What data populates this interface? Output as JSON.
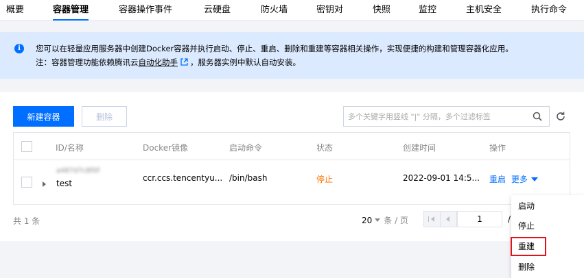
{
  "tabs": [
    {
      "label": "概要"
    },
    {
      "label": "容器管理"
    },
    {
      "label": "容器操作事件"
    },
    {
      "label": "云硬盘"
    },
    {
      "label": "防火墙"
    },
    {
      "label": "密钥对"
    },
    {
      "label": "快照"
    },
    {
      "label": "监控"
    },
    {
      "label": "主机安全"
    },
    {
      "label": "执行命令"
    }
  ],
  "active_tab": "容器管理",
  "banner": {
    "line1": "您可以在轻量应用服务器中创建Docker容器并执行启动、停止、重启、删除和重建等容器相关操作，实现便捷的构建和管理容器化应用。",
    "line2_prefix": "注：容器管理功能依赖腾讯云",
    "line2_link": "自动化助手",
    "line2_suffix": "，服务器实例中默认自动安装。"
  },
  "toolbar": {
    "new_label": "新建容器",
    "delete_label": "删除",
    "search_placeholder": "多个关键字用竖线 \"|\" 分隔，多个过滤标签"
  },
  "table": {
    "headers": [
      "ID/名称",
      "Docker镜像",
      "启动命令",
      "状态",
      "创建时间",
      "操作"
    ],
    "rows": [
      {
        "id": "a487d7c8f0f",
        "name": "test",
        "image": "ccr.ccs.tencentyu...",
        "command": "/bin/bash",
        "status": "停止",
        "created": "2022-09-01 14:5...",
        "action_restart": "重启",
        "action_more": "更多"
      }
    ]
  },
  "pagination": {
    "total_label": "共 1 条",
    "page_size": "20",
    "page_size_unit": "条 / 页",
    "current_page": "1",
    "slash": "/"
  },
  "more_menu": {
    "items": [
      {
        "label": "启动"
      },
      {
        "label": "停止"
      },
      {
        "label": "重建"
      },
      {
        "label": "删除"
      }
    ],
    "highlighted": "重建"
  },
  "colors": {
    "primary": "#006eff",
    "banner_bg": "#dceaff",
    "status_stopped": "#ff7200",
    "highlight": "#e0121a"
  }
}
